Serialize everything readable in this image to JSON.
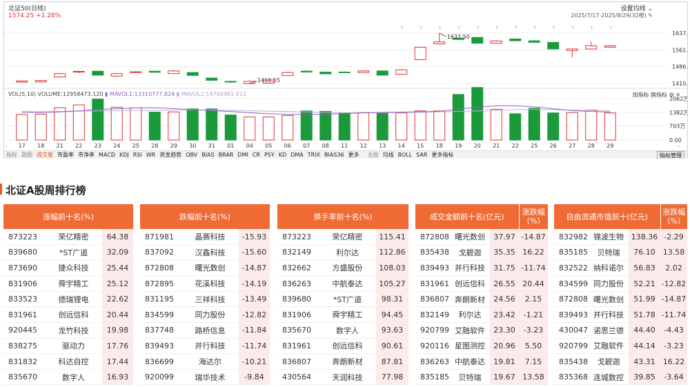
{
  "chart": {
    "title": "北证50(日线)",
    "price_line": "1574.25 +1.28%",
    "settings_label": "设置均线",
    "date_range": "2025/7/17-2025/8/29(32根)",
    "y_ticks": [
      "1637.50",
      "1561.85",
      "1486.20",
      "1410.55"
    ],
    "high_label": "1637.50",
    "low_label": "1410.55",
    "volume_header": "VOL(5,10)  VOLUME:12958473.120",
    "mavol1": "MAVOL1:13310777.824",
    "mavol2": "MAVOL2:14760961.012",
    "vol_right_labels": "加指标  换指标",
    "vol_ticks": [
      "2062万",
      "1382万",
      "703万",
      "0.00"
    ],
    "x_labels": [
      "17",
      "18",
      "21",
      "22",
      "23",
      "24",
      "25",
      "28",
      "29",
      "30",
      "31",
      "01",
      "04",
      "05",
      "06",
      "07",
      "08",
      "11",
      "12",
      "13",
      "14",
      "15",
      "18",
      "19",
      "20",
      "21",
      "22",
      "25",
      "26",
      "27",
      "28",
      "29"
    ],
    "candles": [
      {
        "o": 1417,
        "c": 1422,
        "h": 1424,
        "l": 1415
      },
      {
        "o": 1418,
        "c": 1424,
        "h": 1426,
        "l": 1416
      },
      {
        "o": 1440,
        "c": 1455,
        "h": 1458,
        "l": 1438
      },
      {
        "o": 1462,
        "c": 1465,
        "h": 1468,
        "l": 1458
      },
      {
        "o": 1466,
        "c": 1448,
        "h": 1468,
        "l": 1446
      },
      {
        "o": 1444,
        "c": 1455,
        "h": 1458,
        "l": 1442
      },
      {
        "o": 1460,
        "c": 1463,
        "h": 1466,
        "l": 1457
      },
      {
        "o": 1466,
        "c": 1461,
        "h": 1468,
        "l": 1459
      },
      {
        "o": 1455,
        "c": 1467,
        "h": 1470,
        "l": 1453
      },
      {
        "o": 1460,
        "c": 1447,
        "h": 1461,
        "l": 1445
      },
      {
        "o": 1435,
        "c": 1425,
        "h": 1437,
        "l": 1422
      },
      {
        "o": 1420,
        "c": 1417,
        "h": 1423,
        "l": 1414
      },
      {
        "o": 1410,
        "c": 1420,
        "h": 1424,
        "l": 1408
      },
      {
        "o": 1412,
        "c": 1426,
        "h": 1430,
        "l": 1411
      },
      {
        "o": 1446,
        "c": 1460,
        "h": 1463,
        "l": 1444
      },
      {
        "o": 1466,
        "c": 1462,
        "h": 1470,
        "l": 1460
      },
      {
        "o": 1462,
        "c": 1454,
        "h": 1465,
        "l": 1452
      },
      {
        "o": 1462,
        "c": 1460,
        "h": 1465,
        "l": 1458
      },
      {
        "o": 1460,
        "c": 1467,
        "h": 1470,
        "l": 1458
      },
      {
        "o": 1467,
        "c": 1448,
        "h": 1470,
        "l": 1446
      },
      {
        "o": 1452,
        "c": 1472,
        "h": 1475,
        "l": 1451
      },
      {
        "o": 1518,
        "c": 1574,
        "h": 1577,
        "l": 1516
      },
      {
        "o": 1589,
        "c": 1598,
        "h": 1637.5,
        "l": 1587
      },
      {
        "o": 1615,
        "c": 1609,
        "h": 1617,
        "l": 1606
      },
      {
        "o": 1618,
        "c": 1592,
        "h": 1620,
        "l": 1590
      },
      {
        "o": 1592,
        "c": 1602,
        "h": 1606,
        "l": 1590
      },
      {
        "o": 1611,
        "c": 1603,
        "h": 1614,
        "l": 1601
      },
      {
        "o": 1603,
        "c": 1596,
        "h": 1606,
        "l": 1594
      },
      {
        "o": 1596,
        "c": 1566,
        "h": 1598,
        "l": 1564
      },
      {
        "o": 1559,
        "c": 1566,
        "h": 1569,
        "l": 1528
      },
      {
        "o": 1566,
        "c": 1580,
        "h": 1600,
        "l": 1564
      },
      {
        "o": 1574,
        "c": 1580,
        "h": 1582,
        "l": 1571
      }
    ],
    "volumes_wan": [
      1270,
      1290,
      1610,
      1750,
      2040,
      1630,
      1600,
      1390,
      1400,
      1550,
      1550,
      1250,
      1150,
      1150,
      1220,
      1450,
      1430,
      1350,
      1370,
      1350,
      1350,
      1450,
      1450,
      2270,
      2620,
      1530,
      1310,
      1580,
      1350,
      1370,
      1490,
      1350
    ],
    "mavol1_wan": [
      1380,
      1360,
      1400,
      1450,
      1520,
      1560,
      1600,
      1610,
      1570,
      1510,
      1470,
      1420,
      1360,
      1310,
      1280,
      1270,
      1290,
      1320,
      1350,
      1380,
      1390,
      1410,
      1430,
      1530,
      1650,
      1700,
      1710,
      1650,
      1560,
      1470,
      1420,
      1400
    ],
    "mavol2_wan": [
      1420,
      1420,
      1430,
      1440,
      1450,
      1460,
      1470,
      1480,
      1490,
      1500,
      1490,
      1480,
      1460,
      1440,
      1420,
      1400,
      1380,
      1360,
      1360,
      1360,
      1370,
      1380,
      1400,
      1420,
      1450,
      1480,
      1510,
      1520,
      1510,
      1490,
      1470,
      1450
    ],
    "colors": {
      "up": "#e03030",
      "down": "#1a9a3a",
      "mavol1": "#9060c0",
      "mavol2": "#c0b0d8"
    }
  },
  "indicator_bar": {
    "left_items": [
      "指标",
      "副图",
      "成交量",
      "市盈率",
      "市净率",
      "MACD",
      "KDJ",
      "RSI",
      "WR",
      "资金趋势",
      "OBV",
      "BIAS",
      "BRAR",
      "DMI",
      "CR",
      "PSY",
      "KD",
      "DMA",
      "TRIX",
      "BIAS36",
      "更多"
    ],
    "right_items": [
      "主图",
      "均线",
      "BOLL",
      "SAR",
      "更多指标"
    ],
    "manage": "指标管理"
  },
  "section_title": "北证A股周排行榜",
  "tables": [
    {
      "header": "涨幅前十名(%)",
      "rows": [
        [
          "873223",
          "荣亿精密",
          "64.38"
        ],
        [
          "839680",
          "*ST广道",
          "32.09"
        ],
        [
          "873690",
          "捷众科技",
          "25.44"
        ],
        [
          "831906",
          "舜宇精工",
          "25.12"
        ],
        [
          "833523",
          "德瑞锂电",
          "22.62"
        ],
        [
          "831961",
          "创远信科",
          "20.44"
        ],
        [
          "920445",
          "龙竹科技",
          "19.98"
        ],
        [
          "838275",
          "驱动力",
          "17.76"
        ],
        [
          "831832",
          "科达自控",
          "17.44"
        ],
        [
          "835670",
          "数字人",
          "16.93"
        ]
      ]
    },
    {
      "header": "跌幅前十名(%)",
      "rows": [
        [
          "871981",
          "晶赛科技",
          "-15.93"
        ],
        [
          "837092",
          "汉鑫科技",
          "-15.60"
        ],
        [
          "872808",
          "曙光数创",
          "-14.87"
        ],
        [
          "872895",
          "花溪科技",
          "-14.19"
        ],
        [
          "831195",
          "三祥科技",
          "-13.49"
        ],
        [
          "834599",
          "同力股份",
          "-12.82"
        ],
        [
          "837748",
          "路桥信息",
          "-11.84"
        ],
        [
          "839493",
          "并行科技",
          "-11.74"
        ],
        [
          "836699",
          "海达尔",
          "-10.21"
        ],
        [
          "920099",
          "瑞华技术",
          "-9.84"
        ]
      ]
    },
    {
      "header": "换手率前十名(%)",
      "rows": [
        [
          "873223",
          "荣亿精密",
          "115.41"
        ],
        [
          "832149",
          "利尔达",
          "112.86"
        ],
        [
          "832662",
          "方盛股份",
          "108.03"
        ],
        [
          "836263",
          "中航泰达",
          "105.27"
        ],
        [
          "839680",
          "*ST广道",
          "98.31"
        ],
        [
          "831906",
          "舜宇精工",
          "94.45"
        ],
        [
          "835670",
          "数字人",
          "93.63"
        ],
        [
          "831961",
          "创远信科",
          "90.61"
        ],
        [
          "836807",
          "奔朗新材",
          "87.81"
        ],
        [
          "430564",
          "天润科技",
          "77.98"
        ]
      ]
    },
    {
      "header": "成交金额前十名(亿元)",
      "header2": "涨跌幅（%）",
      "rows": [
        [
          "872808",
          "曙光数创",
          "37.97",
          "-14.87"
        ],
        [
          "835438",
          "戈碧迦",
          "35.35",
          "16.22"
        ],
        [
          "839493",
          "并行科技",
          "31.75",
          "-11.74"
        ],
        [
          "831961",
          "创远信科",
          "26.55",
          "20.44"
        ],
        [
          "836807",
          "奔朗新材",
          "24.56",
          "2.15"
        ],
        [
          "832149",
          "利尔达",
          "23.42",
          "-1.21"
        ],
        [
          "920799",
          "艾融软件",
          "23.30",
          "-3.23"
        ],
        [
          "920116",
          "星图测控",
          "20.96",
          "5.50"
        ],
        [
          "836263",
          "中航泰达",
          "19.81",
          "7.15"
        ],
        [
          "835185",
          "贝特瑞",
          "19.67",
          "13.58"
        ]
      ]
    },
    {
      "header": "自由流通市值前十(亿元)",
      "header2": "涨跌幅（%）",
      "rows": [
        [
          "832982",
          "锦波生物",
          "138.36",
          "-2.29"
        ],
        [
          "835185",
          "贝特瑞",
          "76.10",
          "13.58"
        ],
        [
          "832522",
          "纳科诺尔",
          "56.83",
          "2.02"
        ],
        [
          "834599",
          "同力股份",
          "52.21",
          "-12.82"
        ],
        [
          "872808",
          "曙光数创",
          "51.99",
          "-14.87"
        ],
        [
          "839493",
          "并行科技",
          "51.78",
          "-11.74"
        ],
        [
          "430047",
          "诺思兰德",
          "44.40",
          "-4.43"
        ],
        [
          "920799",
          "艾融软件",
          "44.14",
          "-3.23"
        ],
        [
          "835438",
          "戈碧迦",
          "43.31",
          "16.22"
        ],
        [
          "835368",
          "连城数控",
          "39.85",
          "-3.64"
        ]
      ]
    }
  ]
}
